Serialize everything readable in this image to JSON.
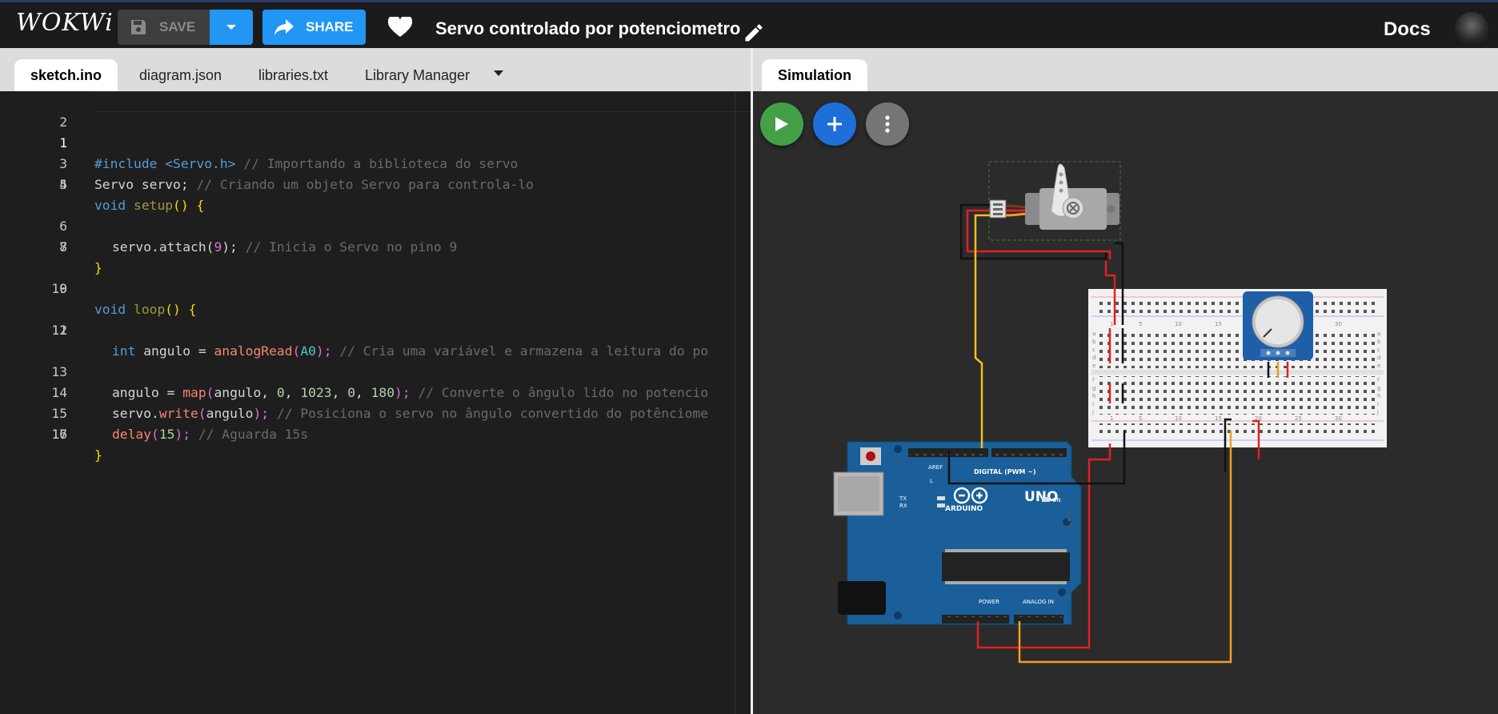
{
  "app": {
    "logo": "WOKWi",
    "docs_label": "Docs"
  },
  "toolbar": {
    "save_label": "SAVE",
    "share_label": "SHARE",
    "project_title": "Servo controlado por potenciometro"
  },
  "editor": {
    "tabs": [
      "sketch.ino",
      "diagram.json",
      "libraries.txt",
      "Library Manager"
    ],
    "active_tab": "sketch.ino",
    "lines": [
      "1",
      "2",
      "3",
      "4",
      "5",
      "6",
      "7",
      "8",
      "9",
      "10",
      "11",
      "12",
      "13",
      "14",
      "15",
      "16",
      "17"
    ],
    "code": {
      "l1_inc": "#include",
      "l1_hdr": "<Servo.h>",
      "l1_cm": "// Importando a biblioteca do servo",
      "l3_a": "Servo servo;",
      "l3_cm": "// Criando um objeto Servo para controla-lo",
      "l4_void": "void",
      "l4_fn": "setup",
      "l4_par": "()",
      "l4_br": "{",
      "l6_a": "servo.attach(",
      "l6_n": "9",
      "l6_b": ");",
      "l6_cm": "// Inicia o Servo no pino 9",
      "l7_br": "}",
      "l9_void": "void",
      "l9_fn": "loop",
      "l9_par": "()",
      "l9_br": "{",
      "l11_int": "int",
      "l11_a": "angulo =",
      "l11_call": "analogRead",
      "l11_p1": "(",
      "l11_arg": "A0",
      "l11_p2": ");",
      "l11_cm": "// Cria uma variável e armazena a leitura do po",
      "l13_a": "angulo =",
      "l13_call": "map",
      "l13_p1": "(",
      "l13_b": "angulo,",
      "l13_n1": "0",
      "l13_c1": ",",
      "l13_n2": "1023",
      "l13_c2": ",",
      "l13_n3": "0",
      "l13_c3": ",",
      "l13_n4": "180",
      "l13_p2": ");",
      "l13_cm": "// Converte o ângulo lido no potencio",
      "l14_a": "servo.",
      "l14_call": "write",
      "l14_p1": "(",
      "l14_b": "angulo",
      "l14_p2": ");",
      "l14_cm": "// Posiciona o servo no ângulo convertido do potênciome",
      "l15_call": "delay",
      "l15_p1": "(",
      "l15_n": "15",
      "l15_p2": ");",
      "l15_cm": "// Aguarda 15s",
      "l16_br": "}"
    }
  },
  "simulation": {
    "tab_label": "Simulation",
    "board": {
      "brand": "ARDUINO",
      "model": "UNO",
      "on_label": "ON",
      "digital_label": "DIGITAL (PWM ~)",
      "power_label": "POWER",
      "analog_label": "ANALOG IN",
      "tx": "TX",
      "rx": "RX",
      "aref": "AREF",
      "l": "L"
    },
    "breadboard": {
      "col_labels": [
        "1",
        "5",
        "10",
        "15",
        "20",
        "25",
        "30"
      ],
      "row_labels_top": [
        "a",
        "b",
        "c",
        "d",
        "e"
      ],
      "row_labels_bottom": [
        "f",
        "g",
        "h",
        "i",
        "j"
      ]
    }
  },
  "colors": {
    "accent": "#2196f3",
    "play": "#43a047",
    "add": "#1e6fd8",
    "more": "#757575"
  }
}
